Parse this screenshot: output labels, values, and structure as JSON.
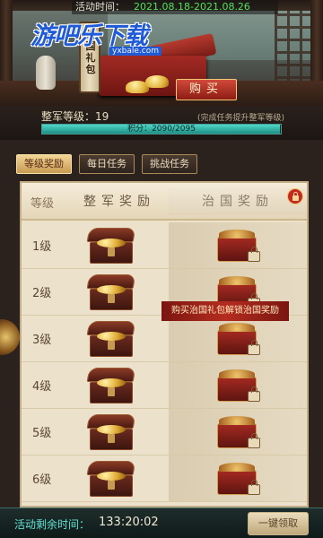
{
  "header": {
    "event_label": "活动时间：",
    "event_dates": "2021.08.18-2021.08.26",
    "watermark": "游吧乐下载",
    "watermark_sub": "yxbale.com",
    "scroll_text": "治国礼包",
    "buy_button": "购买"
  },
  "level": {
    "label": "整军等级：19",
    "hint": "(完成任务提升整军等级)",
    "points_text": "积分：2090/2095",
    "progress_fraction": 0.9976
  },
  "tabs": [
    {
      "label": "等级奖励",
      "active": true
    },
    {
      "label": "每日任务",
      "active": false
    },
    {
      "label": "挑战任务",
      "active": false
    }
  ],
  "board": {
    "col_level": "等级",
    "col_free": "整军奖励",
    "col_gov": "治国奖励",
    "rows": [
      {
        "level": "1级"
      },
      {
        "level": "2级"
      },
      {
        "level": "3级"
      },
      {
        "level": "4级"
      },
      {
        "level": "5级"
      },
      {
        "level": "6级"
      }
    ],
    "unlock_banner": "购买治国礼包解锁治国奖励"
  },
  "footer": {
    "remain_label": "活动剩余时间：",
    "remain_time": "133:20:02",
    "claim_button": "一键领取"
  },
  "colors": {
    "accent_teal": "#4fd8c9",
    "accent_red": "#b52c20",
    "gold": "#c79a52"
  }
}
